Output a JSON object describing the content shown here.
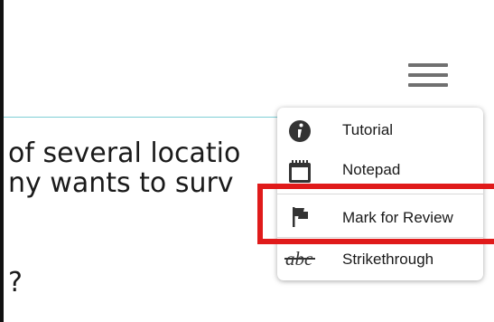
{
  "content": {
    "line1": "of several locatio",
    "line2": "ny wants to surv",
    "line3": "?"
  },
  "menu": {
    "items": [
      {
        "label": "Tutorial",
        "icon": "info-icon"
      },
      {
        "label": "Notepad",
        "icon": "notepad-icon"
      },
      {
        "label": "Mark for Review",
        "icon": "flag-icon"
      },
      {
        "label": "Strikethrough",
        "icon": "strikethrough-icon"
      }
    ],
    "strike_icon_text": "abc"
  },
  "colors": {
    "highlight": "#e01a1a",
    "accent_rule": "#7fcfd6",
    "icon": "#333333"
  }
}
